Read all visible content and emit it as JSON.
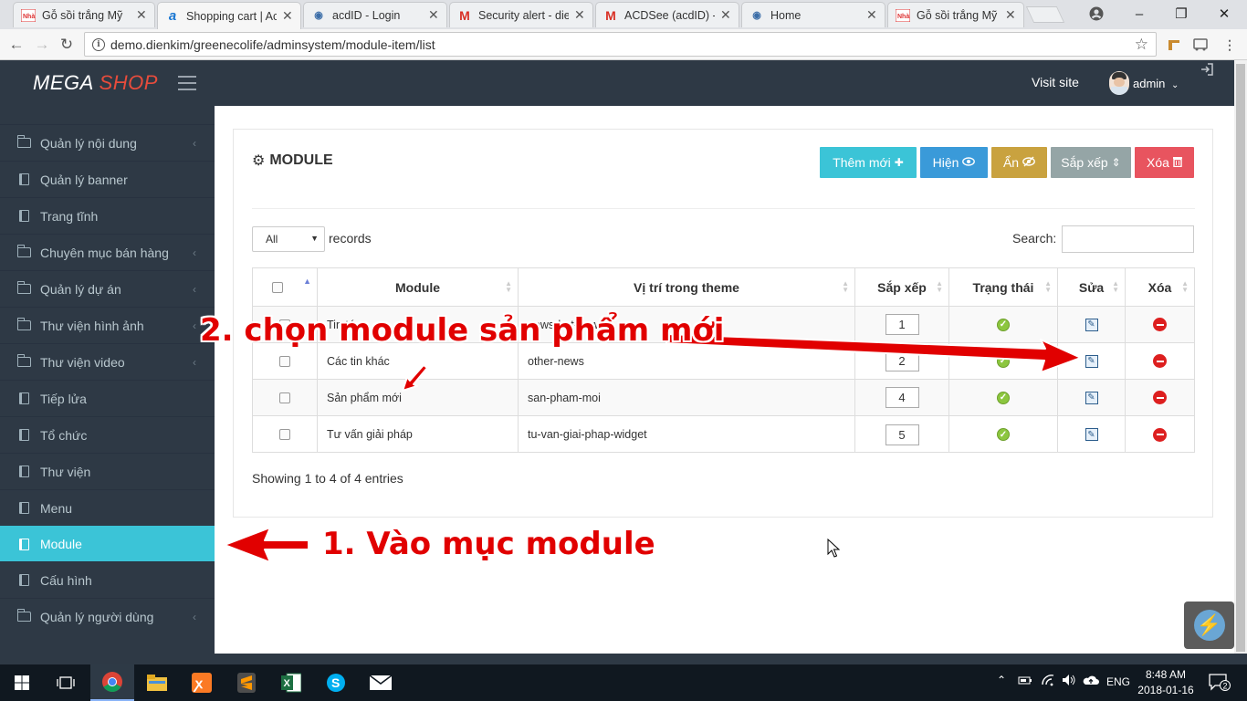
{
  "browser": {
    "tabs": [
      {
        "title": "Gỗ sồi trắng Mỹ",
        "favicon": "site-icon"
      },
      {
        "title": "Shopping cart | Ac",
        "favicon": "a-icon"
      },
      {
        "title": "acdID - Login",
        "favicon": "eye-icon"
      },
      {
        "title": "Security alert - die",
        "favicon": "gmail-icon"
      },
      {
        "title": "ACDSee (acdID) - I",
        "favicon": "gmail-icon"
      },
      {
        "title": "Home",
        "favicon": "eye-icon"
      },
      {
        "title": "Gỗ sồi trắng Mỹ",
        "favicon": "site-icon"
      }
    ],
    "active_tab": 1,
    "url": "demo.dienkim/greenecolife/adminsystem/module-item/list"
  },
  "header": {
    "logo_part1": "MEGA",
    "logo_part2": "SHOP",
    "visit_site": "Visit site",
    "user": "admin",
    "brand_red": "#e74c3c",
    "bg": "#2e3945"
  },
  "sidebar": {
    "items": [
      {
        "label": "Quản lý nội dung",
        "icon": "folder-icon",
        "submenu": true
      },
      {
        "label": "Quản lý banner",
        "icon": "book-icon",
        "submenu": false
      },
      {
        "label": "Trang tĩnh",
        "icon": "book-icon",
        "submenu": false
      },
      {
        "label": "Chuyên mục bán hàng",
        "icon": "folder-icon",
        "submenu": true
      },
      {
        "label": "Quản lý dự án",
        "icon": "folder-icon",
        "submenu": true
      },
      {
        "label": "Thư viện hình ảnh",
        "icon": "folder-icon",
        "submenu": true
      },
      {
        "label": "Thư viện video",
        "icon": "folder-icon",
        "submenu": true
      },
      {
        "label": "Tiếp lửa",
        "icon": "book-icon",
        "submenu": false
      },
      {
        "label": "Tổ chức",
        "icon": "book-icon",
        "submenu": false
      },
      {
        "label": "Thư viện",
        "icon": "book-icon",
        "submenu": false
      },
      {
        "label": "Menu",
        "icon": "book-icon",
        "submenu": false
      },
      {
        "label": "Module",
        "icon": "book-icon",
        "submenu": false,
        "active": true
      },
      {
        "label": "Cấu hình",
        "icon": "book-icon",
        "submenu": false
      },
      {
        "label": "Quản lý người dùng",
        "icon": "folder-icon",
        "submenu": true
      }
    ],
    "active_color": "#3bc4d7"
  },
  "panel": {
    "title": "MODULE",
    "buttons": [
      {
        "label": "Thêm mới",
        "glyph": "✚",
        "color": "#3bc4d7"
      },
      {
        "label": "Hiện",
        "glyph": "👁",
        "color": "#3a9ad9"
      },
      {
        "label": "Ẩn",
        "glyph": "◉",
        "color": "#c9a23f"
      },
      {
        "label": "Sắp xếp",
        "glyph": "⇕",
        "color": "#95a5a6"
      },
      {
        "label": "Xóa",
        "glyph": "🗑",
        "color": "#e8545f"
      }
    ],
    "length_value": "All",
    "length_label": "records",
    "search_label": "Search:",
    "search_value": "",
    "columns": [
      "Module",
      "Vị trí trong theme",
      "Sắp xếp",
      "Trạng thái",
      "Sửa",
      "Xóa"
    ],
    "rows": [
      {
        "module": "Tin tức",
        "position": "news-hot-news",
        "order": "1",
        "status": "active"
      },
      {
        "module": "Các tin khác",
        "position": "other-news",
        "order": "2",
        "status": "active"
      },
      {
        "module": "Sản phẩm mới",
        "position": "san-pham-moi",
        "order": "4",
        "status": "active"
      },
      {
        "module": "Tư vấn giải pháp",
        "position": "tu-van-giai-phap-widget",
        "order": "5",
        "status": "active"
      }
    ],
    "info": "Showing 1 to 4 of 4 entries"
  },
  "annotations": {
    "step1": "1. Vào mục module",
    "step2": "2. chọn module sản phẩm mới",
    "color": "#e10000"
  },
  "taskbar": {
    "apps": [
      "windows-icon",
      "task-view-icon",
      "chrome-icon",
      "file-explorer-icon",
      "xampp-icon",
      "sublime-icon",
      "excel-icon",
      "skype-icon",
      "mail-icon"
    ],
    "lang": "ENG",
    "time": "8:48 AM",
    "date": "2018-01-16",
    "notifications": "2"
  }
}
